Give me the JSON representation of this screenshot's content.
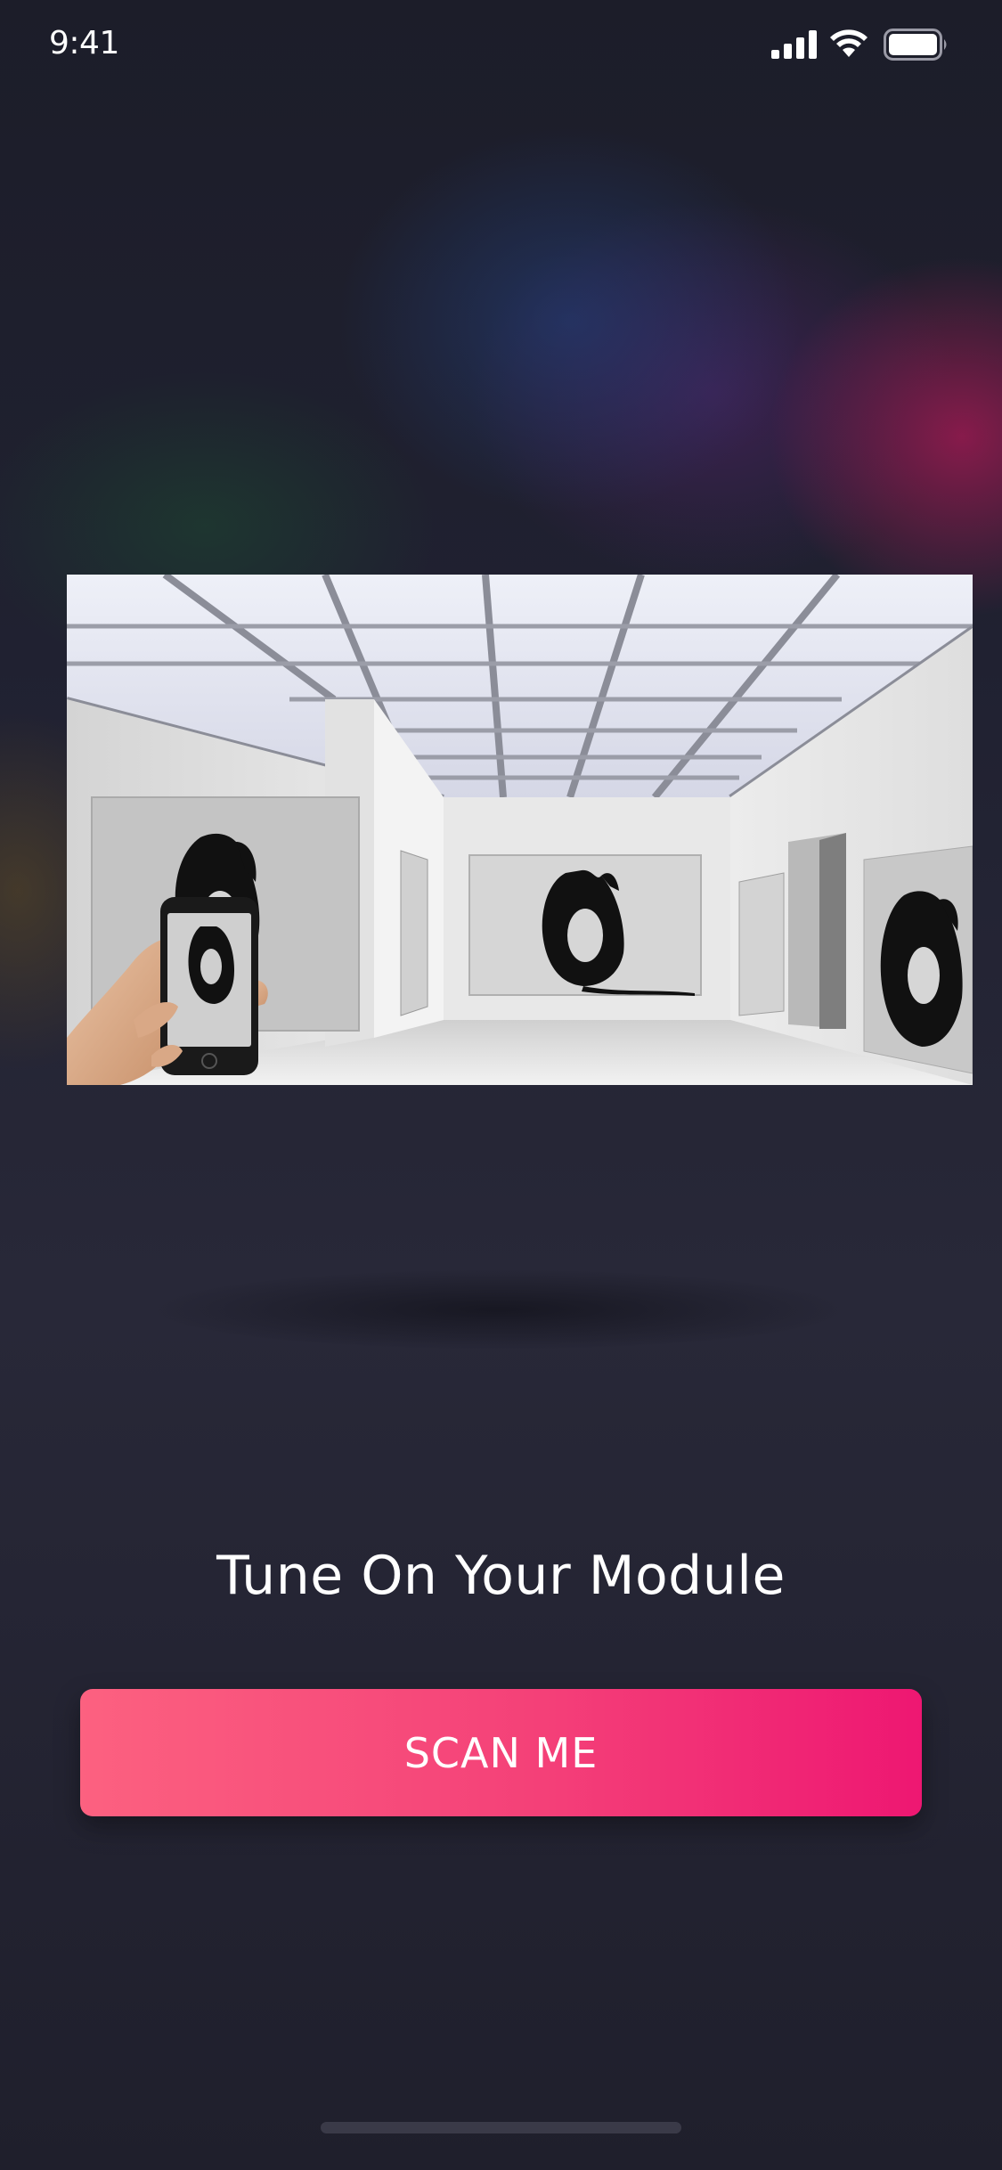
{
  "status_bar": {
    "time": "9:41",
    "icons": [
      "signal-icon",
      "wifi-icon",
      "battery-icon"
    ]
  },
  "hero": {
    "description_icon": "gallery-scan-illustration"
  },
  "main": {
    "title": "Tune On Your Module",
    "scan_button_label": "SCAN ME"
  },
  "colors": {
    "background": "#22222f",
    "button_start": "#fc6180",
    "button_end": "#ee1772",
    "text": "#ffffff"
  }
}
